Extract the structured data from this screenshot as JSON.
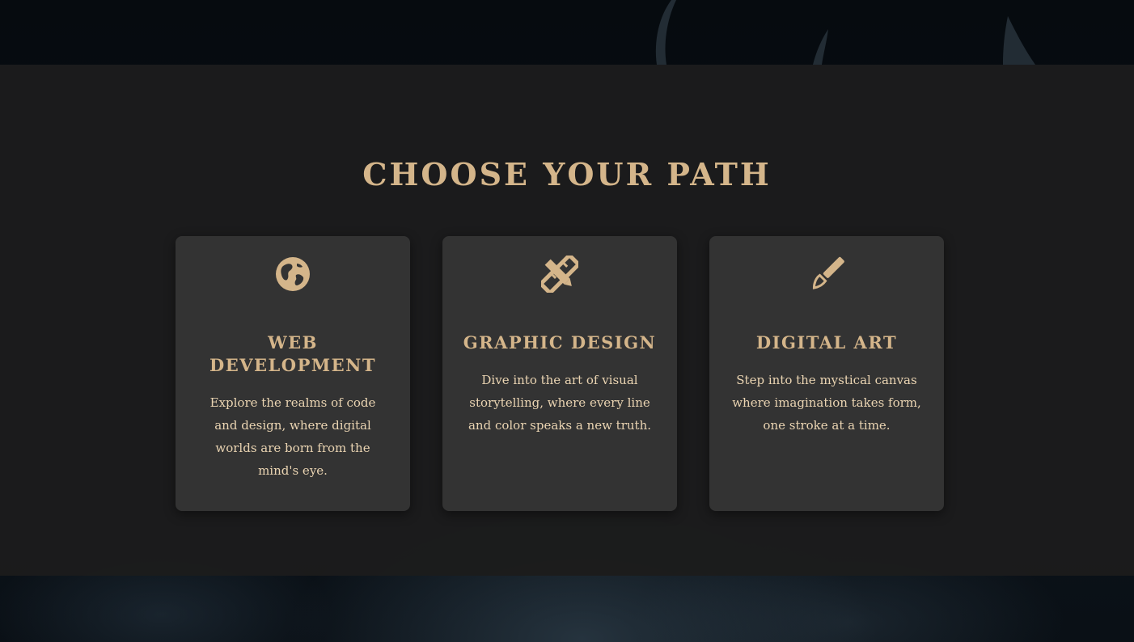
{
  "colors": {
    "accent": "#d4b58a",
    "card_background": "#333333",
    "section_background": "#1c1c1c",
    "body_text": "#ead4b2"
  },
  "section": {
    "title": "CHOOSE YOUR PATH"
  },
  "cards": [
    {
      "icon": "globe-icon",
      "title": "WEB DEVELOPMENT",
      "description": "Explore the realms of code and design, where digital worlds are born from the mind's eye."
    },
    {
      "icon": "ruler-pencil-icon",
      "title": "GRAPHIC DESIGN",
      "description": "Dive into the art of visual storytelling, where every line and color speaks a new truth."
    },
    {
      "icon": "paintbrush-icon",
      "title": "DIGITAL ART",
      "description": "Step into the mystical canvas where imagination takes form, one stroke at a time."
    }
  ]
}
